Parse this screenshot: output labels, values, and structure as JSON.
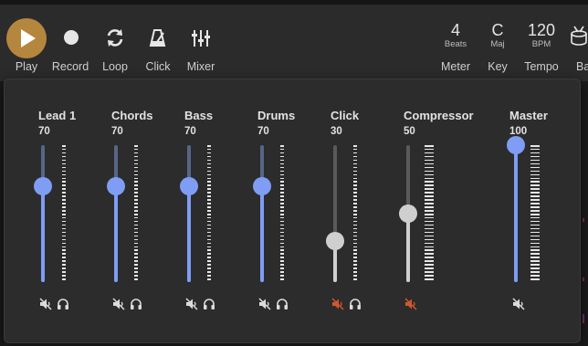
{
  "toolbar": {
    "play": {
      "label": "Play",
      "icon": "play-icon"
    },
    "record": {
      "label": "Record",
      "icon": "record-icon"
    },
    "loop": {
      "label": "Loop",
      "icon": "loop-icon"
    },
    "click": {
      "label": "Click",
      "icon": "metronome-icon"
    },
    "mixer": {
      "label": "Mixer",
      "icon": "mixer-icon"
    },
    "meter": {
      "label": "Meter",
      "value": "4",
      "unit": "Beats"
    },
    "key": {
      "label": "Key",
      "value": "C",
      "unit": "Maj"
    },
    "tempo": {
      "label": "Tempo",
      "value": "120",
      "unit": "BPM"
    },
    "bar": {
      "label": "Ba"
    }
  },
  "colors": {
    "accent": "#b5863e",
    "fader_active": "#7f9df4",
    "fader_inactive": "#cfcfcf",
    "mute_on": "#d2562e"
  },
  "mixer": {
    "channels": [
      {
        "name": "Lead 1",
        "value": "70",
        "level": 0.7,
        "muted": false,
        "has_headphones": true,
        "style": "active"
      },
      {
        "name": "Chords",
        "value": "70",
        "level": 0.7,
        "muted": false,
        "has_headphones": true,
        "style": "active"
      },
      {
        "name": "Bass",
        "value": "70",
        "level": 0.7,
        "muted": false,
        "has_headphones": true,
        "style": "active"
      },
      {
        "name": "Drums",
        "value": "70",
        "level": 0.7,
        "muted": false,
        "has_headphones": true,
        "style": "active"
      },
      {
        "name": "Click",
        "value": "30",
        "level": 0.3,
        "muted": true,
        "has_headphones": true,
        "style": "inactive"
      },
      {
        "name": "Compressor",
        "value": "50",
        "level": 0.5,
        "muted": true,
        "has_headphones": false,
        "style": "inactive"
      },
      {
        "name": "Master",
        "value": "100",
        "level": 1.0,
        "muted": false,
        "has_headphones": false,
        "style": "master"
      }
    ]
  }
}
